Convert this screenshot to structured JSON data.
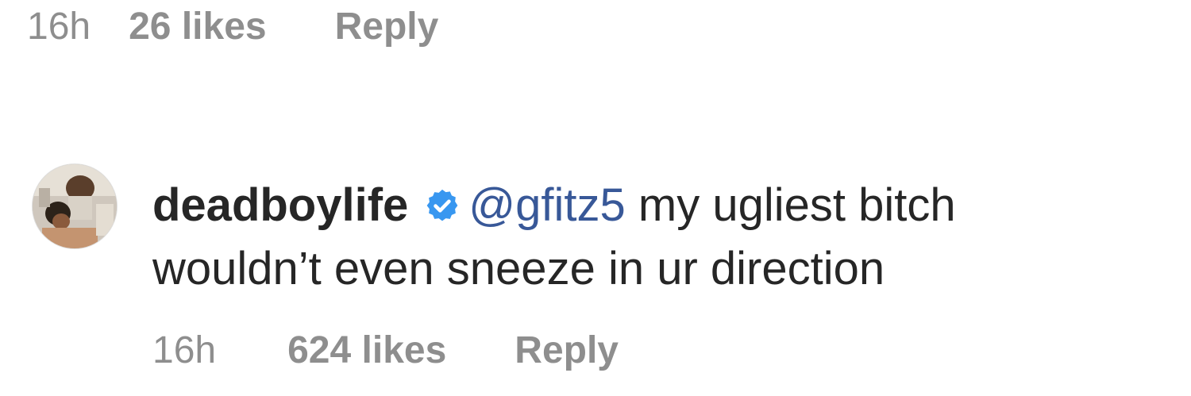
{
  "previous_comment": {
    "time": "16h",
    "likes": "26 likes",
    "reply_label": "Reply"
  },
  "comment": {
    "username": "deadboylife",
    "verified_icon": "verified-badge-icon",
    "mention": "@gfitz5",
    "text_line1": " my ugliest bitch",
    "text_line2": "wouldn’t even sneeze in ur direction",
    "time": "16h",
    "likes": "624 likes",
    "reply_label": "Reply"
  },
  "colors": {
    "meta_gray": "#8e8e8e",
    "text": "#262626",
    "mention_blue": "#385898",
    "verified_blue": "#3897f0"
  }
}
